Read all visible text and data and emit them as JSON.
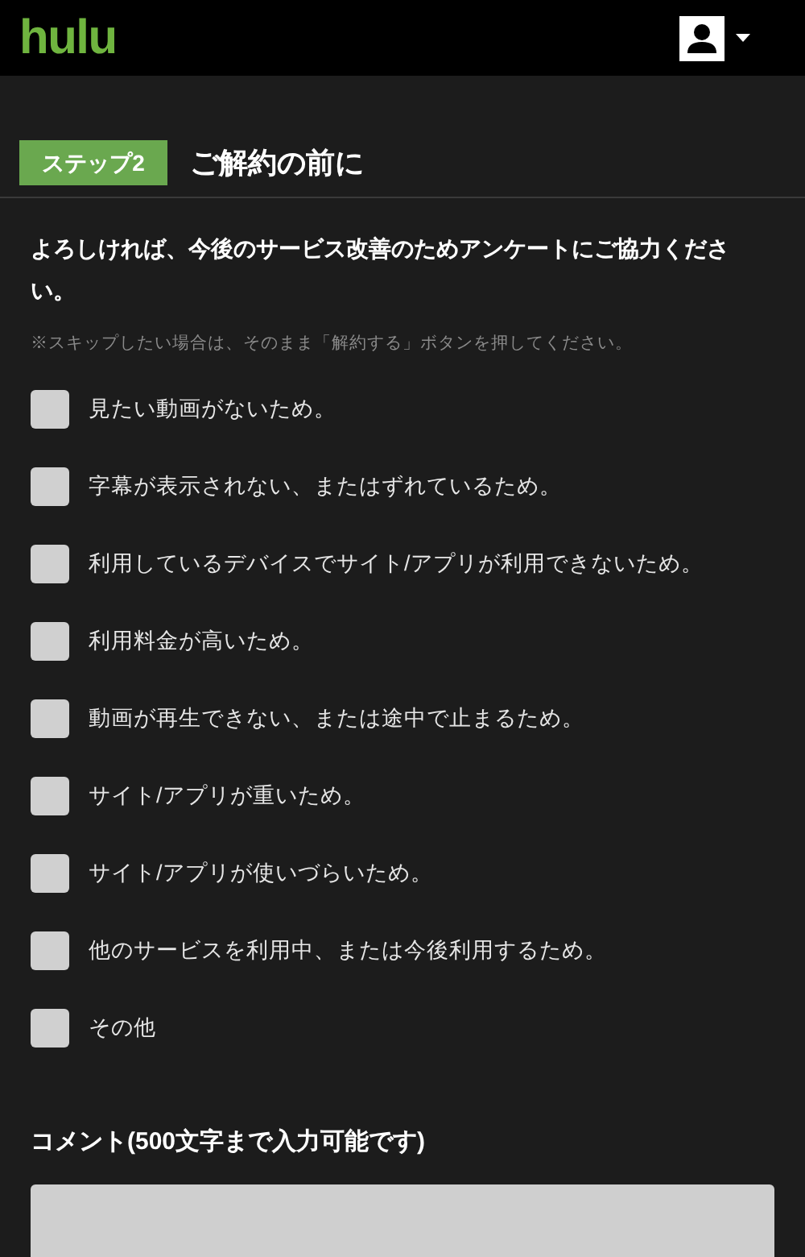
{
  "header": {
    "logo": "hulu"
  },
  "step": {
    "badge": "ステップ2",
    "title": "ご解約の前に"
  },
  "intro": "よろしければ、今後のサービス改善のためアンケートにご協力ください。",
  "note": "※スキップしたい場合は、そのまま「解約する」ボタンを押してください。",
  "reasons": [
    {
      "label": "見たい動画がないため。",
      "checked": false
    },
    {
      "label": "字幕が表示されない、またはずれているため。",
      "checked": false
    },
    {
      "label": "利用しているデバイスでサイト/アプリが利用できないため。",
      "checked": false
    },
    {
      "label": "利用料金が高いため。",
      "checked": false
    },
    {
      "label": "動画が再生できない、または途中で止まるため。",
      "checked": false
    },
    {
      "label": "サイト/アプリが重いため。",
      "checked": false
    },
    {
      "label": "サイト/アプリが使いづらいため。",
      "checked": false
    },
    {
      "label": "他のサービスを利用中、または今後利用するため。",
      "checked": false
    },
    {
      "label": "その他",
      "checked": false
    }
  ],
  "comment": {
    "label": "コメント(500文字まで入力可能です)"
  }
}
